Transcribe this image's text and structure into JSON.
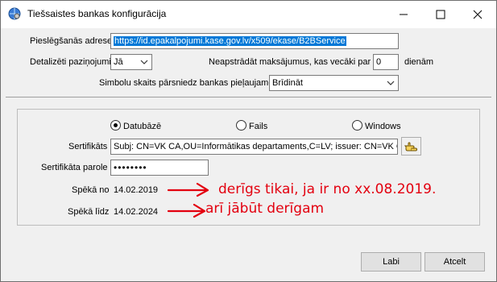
{
  "window": {
    "title": "Tiešsaistes bankas konfigurācija",
    "minimize_glyph": "—",
    "maximize_glyph": "☐",
    "close_glyph": "✕"
  },
  "settings": {
    "address_label": "Pieslēgšanās adrese",
    "address_value": "https://id.epakalpojumi.kase.gov.lv/x509/ekase/B2BService",
    "detailed_label": "Detalizēti paziņojumi",
    "detailed_value": "Jā",
    "unprocessed_label": "Neapstrādāt maksājumus, kas vecāki par",
    "unprocessed_value": "0",
    "unprocessed_unit": "dienām",
    "symbol_label": "Simbolu skaits pārsniedz bankas pieļaujamo",
    "symbol_value": "Brīdināt"
  },
  "cert": {
    "source_options": [
      "Datubāzē",
      "Fails",
      "Windows"
    ],
    "selected_source": "Datubāzē",
    "cert_label": "Sertifikāts",
    "cert_value": "Subj: CN=VK CA,OU=Informātikas departaments,C=LV; issuer: CN=VK C",
    "password_label": "Sertifikāta parole",
    "password_value": "••••••••",
    "valid_from_label": "Spēkā no",
    "valid_from_value": "14.02.2019",
    "valid_to_label": "Spēkā līdz",
    "valid_to_value": "14.02.2024"
  },
  "annotations": {
    "note_valid_from": "derīgs tikai, ja ir no xx.08.2019.",
    "note_valid_to": "arī jābūt derīgam",
    "color": "#e3000f"
  },
  "buttons": {
    "ok": "Labi",
    "cancel": "Atcelt"
  },
  "icons": {
    "app": "globe-gear-icon",
    "browse": "pointing-hand-icon"
  }
}
